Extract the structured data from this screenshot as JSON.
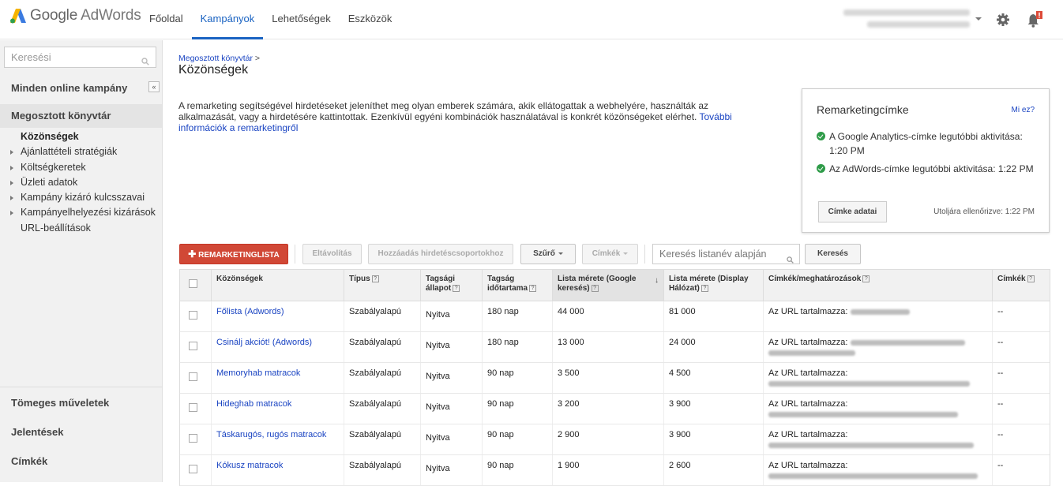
{
  "app": {
    "logo_google": "Google",
    "logo_product": "AdWords"
  },
  "nav": {
    "items": [
      "Főoldal",
      "Kampányok",
      "Lehetőségek",
      "Eszközök"
    ],
    "active": 1
  },
  "sidebar": {
    "search_placeholder": "Keresési",
    "all_campaigns": "Minden online kampány",
    "collapse": "«",
    "shared_library": "Megosztott könyvtár",
    "items": [
      {
        "label": "Közönségek",
        "current": true,
        "expandable": false
      },
      {
        "label": "Ajánlattételi stratégiák",
        "current": false,
        "expandable": true
      },
      {
        "label": "Költségkeretek",
        "current": false,
        "expandable": true
      },
      {
        "label": "Üzleti adatok",
        "current": false,
        "expandable": true
      },
      {
        "label": "Kampány kizáró kulcsszavai",
        "current": false,
        "expandable": true
      },
      {
        "label": "Kampányelhelyezési kizárások",
        "current": false,
        "expandable": true
      },
      {
        "label": "URL-beállítások",
        "current": false,
        "expandable": false
      }
    ],
    "bottom": [
      "Tömeges műveletek",
      "Jelentések",
      "Címkék"
    ]
  },
  "main": {
    "breadcrumb": "Megosztott könyvtár",
    "breadcrumb_sep": ">",
    "title": "Közönségek",
    "intro": "A remarketing segítségével hirdetéseket jeleníthet meg olyan emberek számára, akik ellátogattak a webhelyére, használták az alkalmazását, vagy a hirdetésére kattintottak. Ezenkívül egyéni kombinációk használatával is konkrét közönségeket elérhet. ",
    "intro_link": "További információk a remarketingről"
  },
  "remarketing_panel": {
    "title": "Remarketingcímke",
    "help": "Mi ez?",
    "status1": "A Google Analytics-címke legutóbbi aktivitása: 1:20 PM",
    "status2": "Az AdWords-címke legutóbbi aktivitása: 1:22 PM",
    "button": "Címke adatai",
    "last_checked": "Utoljára ellenőrizve: 1:22 PM"
  },
  "toolbar": {
    "add": "REMARKETINGLISTA",
    "remove": "Eltávolítás",
    "add_to_adgroups": "Hozzáadás hirdetéscsoportokhoz",
    "filter": "Szűrő",
    "labels": "Címkék",
    "search_placeholder": "Keresés listanév alapján",
    "search_button": "Keresés"
  },
  "table": {
    "headers": {
      "audience": "Közönségek",
      "type": "Típus",
      "status": "Tagsági állapot",
      "duration": "Tagság időtartama",
      "size_search": "Lista mérete (Google keresés)",
      "size_display": "Lista mérete (Display Hálózat)",
      "tags": "Címkék/meghatározások",
      "labels": "Címkék"
    },
    "rows": [
      {
        "name": "Főlista (Adwords)",
        "type": "Szabályalapú",
        "status": "Nyitva",
        "duration": "180 nap",
        "search": "44 000",
        "display": "81 000",
        "rule": "Az URL tartalmazza:",
        "label": "--"
      },
      {
        "name": "Csinálj akciót! (Adwords)",
        "type": "Szabályalapú",
        "status": "Nyitva",
        "duration": "180 nap",
        "search": "13 000",
        "display": "24 000",
        "rule": "Az URL tartalmazza:",
        "label": "--"
      },
      {
        "name": "Memoryhab matracok",
        "type": "Szabályalapú",
        "status": "Nyitva",
        "duration": "90 nap",
        "search": "3 500",
        "display": "4 500",
        "rule": "Az URL tartalmazza:",
        "label": "--"
      },
      {
        "name": "Hideghab matracok",
        "type": "Szabályalapú",
        "status": "Nyitva",
        "duration": "90 nap",
        "search": "3 200",
        "display": "3 900",
        "rule": "Az URL tartalmazza:",
        "label": "--"
      },
      {
        "name": "Táskarugós, rugós matracok",
        "type": "Szabályalapú",
        "status": "Nyitva",
        "duration": "90 nap",
        "search": "2 900",
        "display": "3 900",
        "rule": "Az URL tartalmazza:",
        "label": "--"
      },
      {
        "name": "Kókusz matracok",
        "type": "Szabályalapú",
        "status": "Nyitva",
        "duration": "90 nap",
        "search": "1 900",
        "display": "2 600",
        "rule": "Az URL tartalmazza:",
        "label": "--"
      }
    ]
  }
}
